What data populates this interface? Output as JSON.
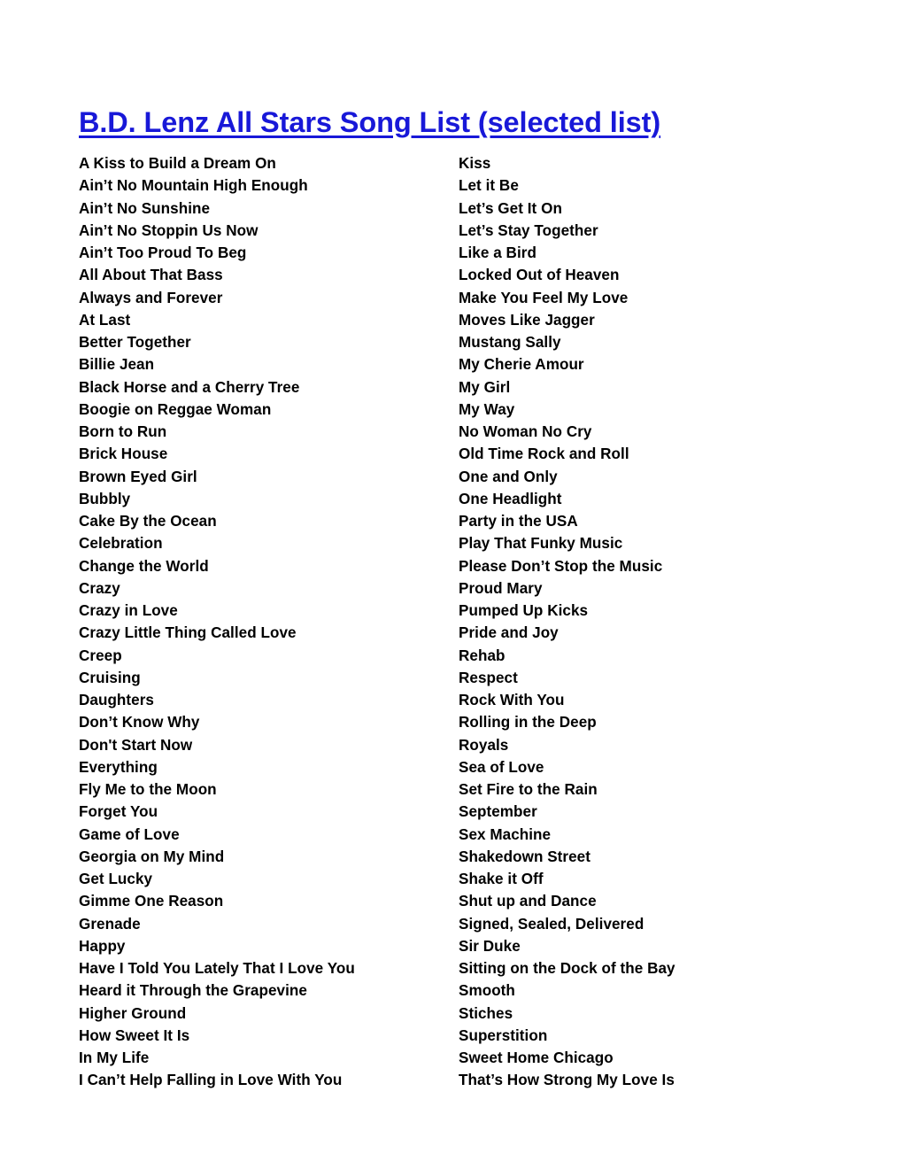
{
  "document": {
    "title": "B.D. Lenz All Stars Song List (selected list)",
    "title_color": "#1818D8",
    "text_color": "#000000",
    "background_color": "#ffffff"
  },
  "song_list": {
    "left_column": [
      "A Kiss to Build a Dream On",
      "Ain’t No Mountain High Enough",
      "Ain’t No Sunshine",
      "Ain’t No Stoppin Us Now",
      "Ain’t Too Proud To Beg",
      "All About That Bass",
      "Always and Forever",
      "At Last",
      "Better Together",
      "Billie Jean",
      "Black Horse and a Cherry Tree",
      "Boogie on Reggae Woman",
      "Born to Run",
      "Brick House",
      "Brown Eyed Girl",
      "Bubbly",
      "Cake By the Ocean",
      "Celebration",
      "Change the World",
      "Crazy",
      "Crazy in Love",
      "Crazy Little Thing Called Love",
      "Creep",
      "Cruising",
      "Daughters",
      "Don’t Know Why",
      "Don't Start Now",
      "Everything",
      "Fly Me to the Moon",
      "Forget You",
      "Game of Love",
      "Georgia on My Mind",
      "Get Lucky",
      "Gimme One Reason",
      "Grenade",
      "Happy",
      "Have I Told You Lately That I Love You",
      "Heard it Through the Grapevine",
      "Higher Ground",
      "How Sweet It Is",
      "In My Life",
      "I Can’t Help Falling in Love With You"
    ],
    "right_column": [
      "Kiss",
      "Let it Be",
      "Let’s Get It On",
      "Let’s Stay Together",
      "Like a Bird",
      "Locked Out of Heaven",
      "Make You Feel My Love",
      "Moves Like Jagger",
      "Mustang Sally",
      "My Cherie Amour",
      "My Girl",
      "My Way",
      "No Woman No Cry",
      "Old Time Rock and Roll",
      "One and Only",
      "One Headlight",
      "Party in the USA",
      "Play That Funky Music",
      "Please Don’t Stop the Music",
      "Proud Mary",
      "Pumped Up Kicks",
      "Pride and Joy",
      "Rehab",
      "Respect",
      "Rock With You",
      "Rolling in the Deep",
      "Royals",
      "Sea of Love",
      "Set Fire to the Rain",
      "September",
      "Sex Machine",
      "Shakedown Street",
      "Shake it Off",
      "Shut up and Dance",
      "Signed, Sealed, Delivered",
      "Sir Duke",
      "Sitting on the Dock of the Bay",
      "Smooth",
      "Stiches",
      "Superstition",
      "Sweet Home Chicago",
      "That’s How Strong My Love Is"
    ]
  }
}
